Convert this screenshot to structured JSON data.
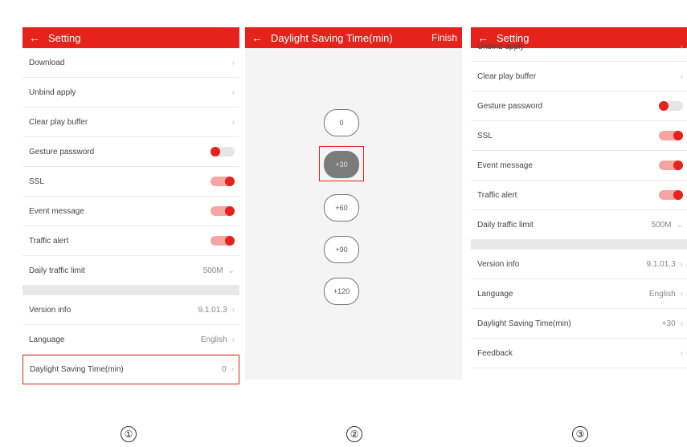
{
  "panel1": {
    "title": "Setting",
    "back": "←",
    "rows": [
      {
        "label": "Download",
        "chev": "›"
      },
      {
        "label": "Unbind apply",
        "chev": "›"
      },
      {
        "label": "Clear play buffer",
        "chev": "›"
      },
      {
        "label": "Gesture password",
        "toggle": "off"
      },
      {
        "label": "SSL",
        "toggle": "on"
      },
      {
        "label": "Event message",
        "toggle": "on"
      },
      {
        "label": "Traffic alert",
        "toggle": "on"
      },
      {
        "label": "Daily traffic limit",
        "value": "500M",
        "chev": "⌄"
      },
      {
        "label": "Version info",
        "value": "9.1.01.3",
        "chev": "›"
      },
      {
        "label": "Language",
        "value": "English",
        "chev": "›"
      },
      {
        "label": "Daylight Saving Time(min)",
        "value": "0",
        "chev": "›"
      }
    ]
  },
  "panel2": {
    "title": "Daylight Saving Time(min)",
    "back": "←",
    "finish": "Finish",
    "options": [
      "0",
      "+30",
      "+60",
      "+90",
      "+120"
    ],
    "selected": "+30"
  },
  "panel3": {
    "title": "Setting",
    "back": "←",
    "rows": [
      {
        "label": "Unbind apply",
        "chev": "›"
      },
      {
        "label": "Clear play buffer",
        "chev": "›"
      },
      {
        "label": "Gesture password",
        "toggle": "off"
      },
      {
        "label": "SSL",
        "toggle": "on"
      },
      {
        "label": "Event message",
        "toggle": "on"
      },
      {
        "label": "Traffic alert",
        "toggle": "on"
      },
      {
        "label": "Daily traffic limit",
        "value": "500M",
        "chev": "⌄"
      },
      {
        "label": "Version info",
        "value": "9.1.01.3",
        "chev": "›"
      },
      {
        "label": "Language",
        "value": "English",
        "chev": "›"
      },
      {
        "label": "Daylight Saving Time(min)",
        "value": "+30",
        "chev": "›"
      },
      {
        "label": "Feedback",
        "chev": "›"
      }
    ]
  },
  "steps": [
    "①",
    "②",
    "③"
  ],
  "colors": {
    "accent": "#e5221b",
    "toggle_on_track": "#f4a6a3",
    "toggle_off_track": "#e6e6e6",
    "selected_option": "#7b7b7b"
  }
}
